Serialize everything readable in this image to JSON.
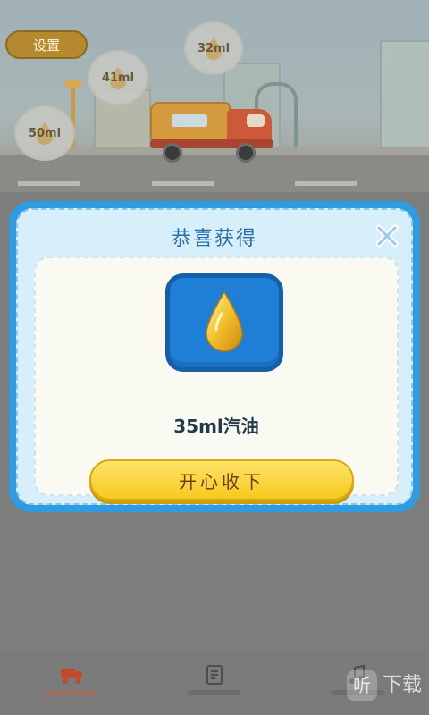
{
  "header": {
    "settings_label": "设置"
  },
  "fuel_bubbles": [
    {
      "label": "32ml"
    },
    {
      "label": "41ml"
    },
    {
      "label": "50ml"
    }
  ],
  "modal": {
    "title": "恭喜获得",
    "reward_text": "35ml汽油",
    "accept_label": "开心收下",
    "icons": {
      "reward": "oil-drop-icon",
      "close": "close-icon"
    }
  },
  "bottom_nav": {
    "items": [
      {
        "label": "",
        "icon": "truck-icon",
        "active": true
      },
      {
        "label": "",
        "icon": "notebook-icon",
        "active": false
      },
      {
        "label": "",
        "icon": "music-note-icon",
        "active": false
      }
    ]
  },
  "watermark": {
    "logo": "听",
    "text": "下载"
  },
  "colors": {
    "modal_border": "#2f9be0",
    "accept_button": "#f5c91d",
    "title_text": "#2a6fad",
    "drop_gold": "#e0a51c"
  }
}
